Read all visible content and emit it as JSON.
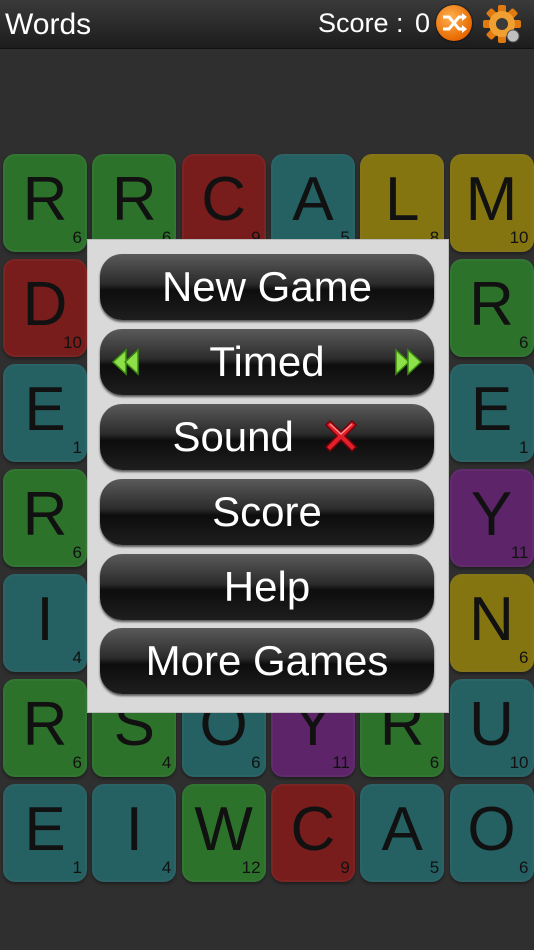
{
  "header": {
    "title": "Words",
    "score_label": "Score :",
    "score_value": "0",
    "shuffle_icon": "shuffle-icon",
    "settings_icon": "gear-icon"
  },
  "board": {
    "tiles": [
      {
        "letter": "R",
        "points": "6",
        "color": "green"
      },
      {
        "letter": "R",
        "points": "6",
        "color": "green"
      },
      {
        "letter": "C",
        "points": "9",
        "color": "red"
      },
      {
        "letter": "A",
        "points": "5",
        "color": "teal"
      },
      {
        "letter": "L",
        "points": "8",
        "color": "yellow"
      },
      {
        "letter": "M",
        "points": "10",
        "color": "yellow"
      },
      {
        "letter": "D",
        "points": "10",
        "color": "red"
      },
      {
        "letter": "",
        "points": "",
        "color": "green"
      },
      {
        "letter": "",
        "points": "",
        "color": "green"
      },
      {
        "letter": "",
        "points": "",
        "color": "teal"
      },
      {
        "letter": "",
        "points": "",
        "color": "yellow"
      },
      {
        "letter": "R",
        "points": "6",
        "color": "green"
      },
      {
        "letter": "E",
        "points": "1",
        "color": "teal"
      },
      {
        "letter": "",
        "points": "",
        "color": "teal"
      },
      {
        "letter": "",
        "points": "",
        "color": "teal"
      },
      {
        "letter": "",
        "points": "",
        "color": "teal"
      },
      {
        "letter": "",
        "points": "",
        "color": "teal"
      },
      {
        "letter": "E",
        "points": "1",
        "color": "teal"
      },
      {
        "letter": "R",
        "points": "6",
        "color": "green"
      },
      {
        "letter": "",
        "points": "",
        "color": "green"
      },
      {
        "letter": "",
        "points": "",
        "color": "green"
      },
      {
        "letter": "",
        "points": "",
        "color": "green"
      },
      {
        "letter": "",
        "points": "",
        "color": "green"
      },
      {
        "letter": "Y",
        "points": "11",
        "color": "purple"
      },
      {
        "letter": "I",
        "points": "4",
        "color": "teal"
      },
      {
        "letter": "",
        "points": "",
        "color": "teal"
      },
      {
        "letter": "",
        "points": "",
        "color": "teal"
      },
      {
        "letter": "",
        "points": "",
        "color": "teal"
      },
      {
        "letter": "",
        "points": "",
        "color": "teal"
      },
      {
        "letter": "N",
        "points": "6",
        "color": "yellow"
      },
      {
        "letter": "R",
        "points": "6",
        "color": "green"
      },
      {
        "letter": "S",
        "points": "4",
        "color": "green"
      },
      {
        "letter": "O",
        "points": "6",
        "color": "teal"
      },
      {
        "letter": "Y",
        "points": "11",
        "color": "purple"
      },
      {
        "letter": "R",
        "points": "6",
        "color": "green"
      },
      {
        "letter": "U",
        "points": "10",
        "color": "teal"
      },
      {
        "letter": "E",
        "points": "1",
        "color": "teal"
      },
      {
        "letter": "I",
        "points": "4",
        "color": "teal"
      },
      {
        "letter": "W",
        "points": "12",
        "color": "green"
      },
      {
        "letter": "C",
        "points": "9",
        "color": "red"
      },
      {
        "letter": "A",
        "points": "5",
        "color": "teal"
      },
      {
        "letter": "O",
        "points": "6",
        "color": "teal"
      }
    ]
  },
  "menu": {
    "new_game": "New Game",
    "mode": "Timed",
    "sound": "Sound",
    "sound_state_icon": "red-x-icon",
    "score": "Score",
    "help": "Help",
    "more_games": "More Games"
  }
}
